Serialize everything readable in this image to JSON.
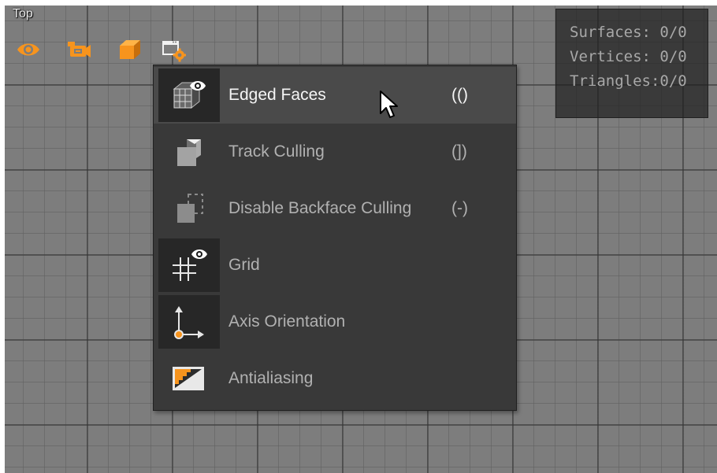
{
  "viewport": {
    "title": "Top"
  },
  "toolbar": {
    "icons": [
      "eye-icon",
      "camera-icon",
      "cube-icon",
      "viewport-settings-icon"
    ],
    "accent_color": "#f7941d"
  },
  "stats": {
    "surfaces": "Surfaces: 0/0",
    "vertices": "Vertices: 0/0",
    "triangles": "Triangles:0/0"
  },
  "menu": {
    "items": [
      {
        "label": "Edged Faces",
        "shortcut": "(()",
        "icon": "edged-faces-icon",
        "highlighted": true
      },
      {
        "label": "Track Culling",
        "shortcut": "(])",
        "icon": "track-culling-icon",
        "highlighted": false
      },
      {
        "label": "Disable Backface Culling",
        "shortcut": "(-)",
        "icon": "disable-backface-culling-icon",
        "highlighted": false
      },
      {
        "label": "Grid",
        "shortcut": "",
        "icon": "grid-icon",
        "highlighted": false
      },
      {
        "label": "Axis Orientation",
        "shortcut": "",
        "icon": "axis-orientation-icon",
        "highlighted": false
      },
      {
        "label": "Antialiasing",
        "shortcut": "",
        "icon": "antialiasing-icon",
        "highlighted": false
      }
    ]
  },
  "cursor": {
    "icon": "mouse-pointer-icon"
  }
}
